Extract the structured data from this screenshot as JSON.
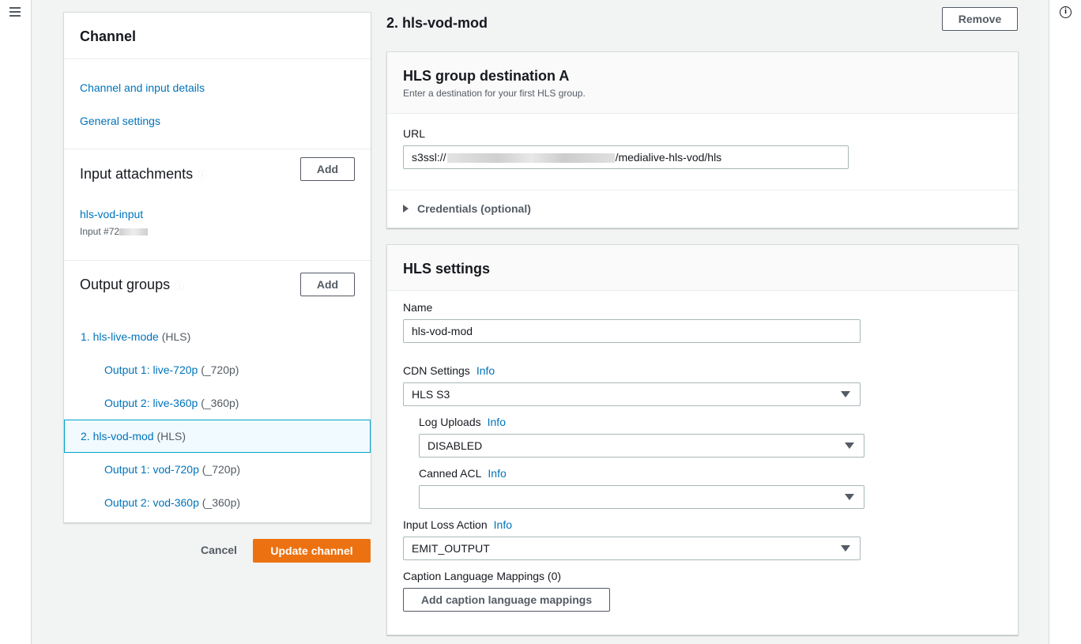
{
  "channel_nav": {
    "title": "Channel",
    "links": [
      "Channel and input details",
      "General settings"
    ],
    "input_attachments": {
      "title": "Input attachments",
      "add_label": "Add",
      "input_name": "hls-vod-input",
      "input_id": "Input #72"
    },
    "output_groups": {
      "title": "Output groups",
      "add_label": "Add",
      "items": [
        {
          "label": "1. hls-live-mode",
          "suffix": "(HLS)"
        },
        {
          "label": "Output 1: live-720p",
          "suffix": "(_720p)"
        },
        {
          "label": "Output 2: live-360p",
          "suffix": "(_360p)"
        },
        {
          "label": "2. hls-vod-mod",
          "suffix": "(HLS)"
        },
        {
          "label": "Output 1: vod-720p",
          "suffix": "(_720p)"
        },
        {
          "label": "Output 2: vod-360p",
          "suffix": "(_360p)"
        }
      ],
      "selected_index": 3
    },
    "cancel_label": "Cancel",
    "update_label": "Update channel"
  },
  "main": {
    "title": "2. hls-vod-mod",
    "remove_label": "Remove",
    "destination": {
      "title": "HLS group destination A",
      "description": "Enter a destination for your first HLS group.",
      "url_label": "URL",
      "url_prefix": "s3ssl://",
      "url_suffix": "/medialive-hls-vod/hls",
      "credentials_label": "Credentials (optional)"
    },
    "hls_settings": {
      "title": "HLS settings",
      "name_label": "Name",
      "name_value": "hls-vod-mod",
      "info_label": "Info",
      "cdn_label": "CDN Settings",
      "cdn_value": "HLS S3",
      "log_uploads_label": "Log Uploads",
      "log_uploads_value": "DISABLED",
      "canned_acl_label": "Canned ACL",
      "canned_acl_value": "",
      "input_loss_label": "Input Loss Action",
      "input_loss_value": "EMIT_OUTPUT",
      "caption_label": "Caption Language Mappings (0)",
      "caption_button": "Add caption language mappings"
    }
  }
}
